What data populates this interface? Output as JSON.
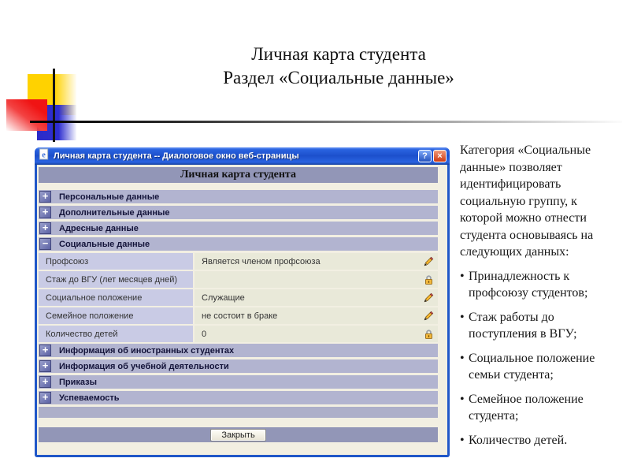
{
  "slide": {
    "title_line1": "Личная карта студента",
    "title_line2": "Раздел «Социальные данные»"
  },
  "dialog": {
    "titlebar": {
      "icon": "ie-page-icon",
      "title": "Личная карта студента -- Диалоговое окно веб-страницы",
      "help_label": "?",
      "close_label": "×"
    },
    "header": "Личная карта студента",
    "sections_top": [
      {
        "label": "Персональные данные",
        "icon_glyph": "+",
        "state": "collapsed"
      },
      {
        "label": "Дополнительные данные",
        "icon_glyph": "+",
        "state": "collapsed"
      },
      {
        "label": "Адресные данные",
        "icon_glyph": "+",
        "state": "collapsed"
      },
      {
        "label": "Социальные данные",
        "icon_glyph": "−",
        "state": "expanded"
      }
    ],
    "rows": [
      {
        "label": "Профсоюз",
        "value": "Является членом профсоюза",
        "icon": "pencil-edit-icon"
      },
      {
        "label": "Стаж до ВГУ (лет месяцев дней)",
        "value": "",
        "icon": "lock-icon"
      },
      {
        "label": "Социальное положение",
        "value": "Служащие",
        "icon": "pencil-edit-icon"
      },
      {
        "label": "Семейное положение",
        "value": "не состоит в браке",
        "icon": "pencil-edit-icon"
      },
      {
        "label": "Количество детей",
        "value": "0",
        "icon": "lock-icon"
      }
    ],
    "sections_bottom": [
      {
        "label": "Информация об иностранных студентах",
        "icon_glyph": "+",
        "state": "collapsed"
      },
      {
        "label": "Информация об учебной деятельности",
        "icon_glyph": "+",
        "state": "collapsed"
      },
      {
        "label": "Приказы",
        "icon_glyph": "+",
        "state": "collapsed"
      },
      {
        "label": "Успеваемость",
        "icon_glyph": "+",
        "state": "collapsed"
      }
    ],
    "close_button_label": "Закрыть"
  },
  "sidebar_text": {
    "paragraph": "Категория «Социальные данные» позволяет идентифицировать социальную группу, к которой можно отнести студента основываясь на следующих данных:",
    "bullets": [
      "Принадлежность к профсоюзу студентов;",
      "Стаж работы до поступления в ВГУ;",
      "Социальное положение семьи студента;",
      "Семейное положение студента;",
      "Количество детей."
    ]
  },
  "colors": {
    "titlebar_blue": "#1c50cc",
    "window_frame": "#2057c8",
    "dialog_bg": "#f2efe2",
    "header_band": "#9296b7",
    "section_header": "#b2b4d0",
    "label_cell": "#c9cbe5",
    "value_cell": "#e9e9d9",
    "close_btn_red": "#cf3a12",
    "decor_yellow": "#ffd200",
    "decor_red": "#ee1c1c",
    "decor_blue": "#2a2ac8"
  }
}
